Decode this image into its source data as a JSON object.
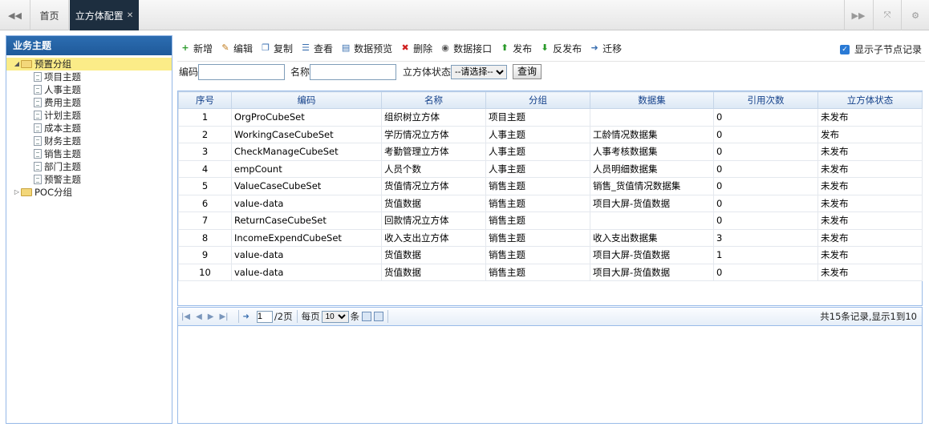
{
  "topbar": {
    "nav_left_icon": "double-left-arrow-icon",
    "home_tab": "首页",
    "active_tab": "立方体配置",
    "tools": [
      "double-right-arrow-icon",
      "fullscreen-icon",
      "gear-icon"
    ]
  },
  "sidebar": {
    "title": "业务主题",
    "tree": [
      {
        "label": "预置分组",
        "type": "folder",
        "expanded": true,
        "selected": true,
        "level": 0
      },
      {
        "label": "项目主题",
        "type": "file",
        "level": 1
      },
      {
        "label": "人事主题",
        "type": "file",
        "level": 1
      },
      {
        "label": "费用主题",
        "type": "file",
        "level": 1
      },
      {
        "label": "计划主题",
        "type": "file",
        "level": 1
      },
      {
        "label": "成本主题",
        "type": "file",
        "level": 1
      },
      {
        "label": "财务主题",
        "type": "file",
        "level": 1
      },
      {
        "label": "销售主题",
        "type": "file",
        "level": 1
      },
      {
        "label": "部门主题",
        "type": "file",
        "level": 1
      },
      {
        "label": "预警主题",
        "type": "file",
        "level": 1
      },
      {
        "label": "POC分组",
        "type": "folder",
        "expanded": false,
        "level": 0
      }
    ]
  },
  "toolbar": {
    "buttons": [
      {
        "label": "新增",
        "icon": "add-icon",
        "color": "#2a9a2a"
      },
      {
        "label": "编辑",
        "icon": "edit-icon",
        "color": "#c07a1a"
      },
      {
        "label": "复制",
        "icon": "copy-icon",
        "color": "#3a6fb0"
      },
      {
        "label": "查看",
        "icon": "view-icon",
        "color": "#3a6fb0"
      },
      {
        "label": "数据预览",
        "icon": "preview-icon",
        "color": "#3a6fb0"
      },
      {
        "label": "删除",
        "icon": "delete-icon",
        "color": "#d02020"
      },
      {
        "label": "数据接口",
        "icon": "interface-icon",
        "color": "#555555"
      },
      {
        "label": "发布",
        "icon": "publish-icon",
        "color": "#2a9a2a"
      },
      {
        "label": "反发布",
        "icon": "unpublish-icon",
        "color": "#2a9a2a"
      },
      {
        "label": "迁移",
        "icon": "migrate-icon",
        "color": "#3a6fb0"
      }
    ],
    "show_child_label": "显示子节点记录"
  },
  "search": {
    "code_label": "编码",
    "name_label": "名称",
    "status_label": "立方体状态",
    "status_selected": "--请选择--",
    "query_button": "查询"
  },
  "grid": {
    "columns": [
      "序号",
      "编码",
      "名称",
      "分组",
      "数据集",
      "引用次数",
      "立方体状态"
    ],
    "rows": [
      [
        "1",
        "OrgProCubeSet",
        "组织树立方体",
        "项目主题",
        "",
        "0",
        "未发布"
      ],
      [
        "2",
        "WorkingCaseCubeSet",
        "学历情况立方体",
        "人事主题",
        "工龄情况数据集",
        "0",
        "发布"
      ],
      [
        "3",
        "CheckManageCubeSet",
        "考勤管理立方体",
        "人事主题",
        "人事考核数据集",
        "0",
        "未发布"
      ],
      [
        "4",
        "empCount",
        "人员个数",
        "人事主题",
        "人员明细数据集",
        "0",
        "未发布"
      ],
      [
        "5",
        "ValueCaseCubeSet",
        "货值情况立方体",
        "销售主题",
        "销售_货值情况数据集",
        "0",
        "未发布"
      ],
      [
        "6",
        "value-data",
        "货值数据",
        "销售主题",
        "项目大屏-货值数据",
        "0",
        "未发布"
      ],
      [
        "7",
        "ReturnCaseCubeSet",
        "回款情况立方体",
        "销售主题",
        "",
        "0",
        "未发布"
      ],
      [
        "8",
        "IncomeExpendCubeSet",
        "收入支出立方体",
        "销售主题",
        "收入支出数据集",
        "3",
        "未发布"
      ],
      [
        "9",
        "value-data",
        "货值数据",
        "销售主题",
        "项目大屏-货值数据",
        "1",
        "未发布"
      ],
      [
        "10",
        "value-data",
        "货值数据",
        "销售主题",
        "项目大屏-货值数据",
        "0",
        "未发布"
      ]
    ]
  },
  "pager": {
    "current_page": "1",
    "total_pages": "/2页",
    "per_page_label": "每页",
    "per_page_value": "10",
    "per_page_unit": "条",
    "info": "共15条记录,显示1到10"
  }
}
